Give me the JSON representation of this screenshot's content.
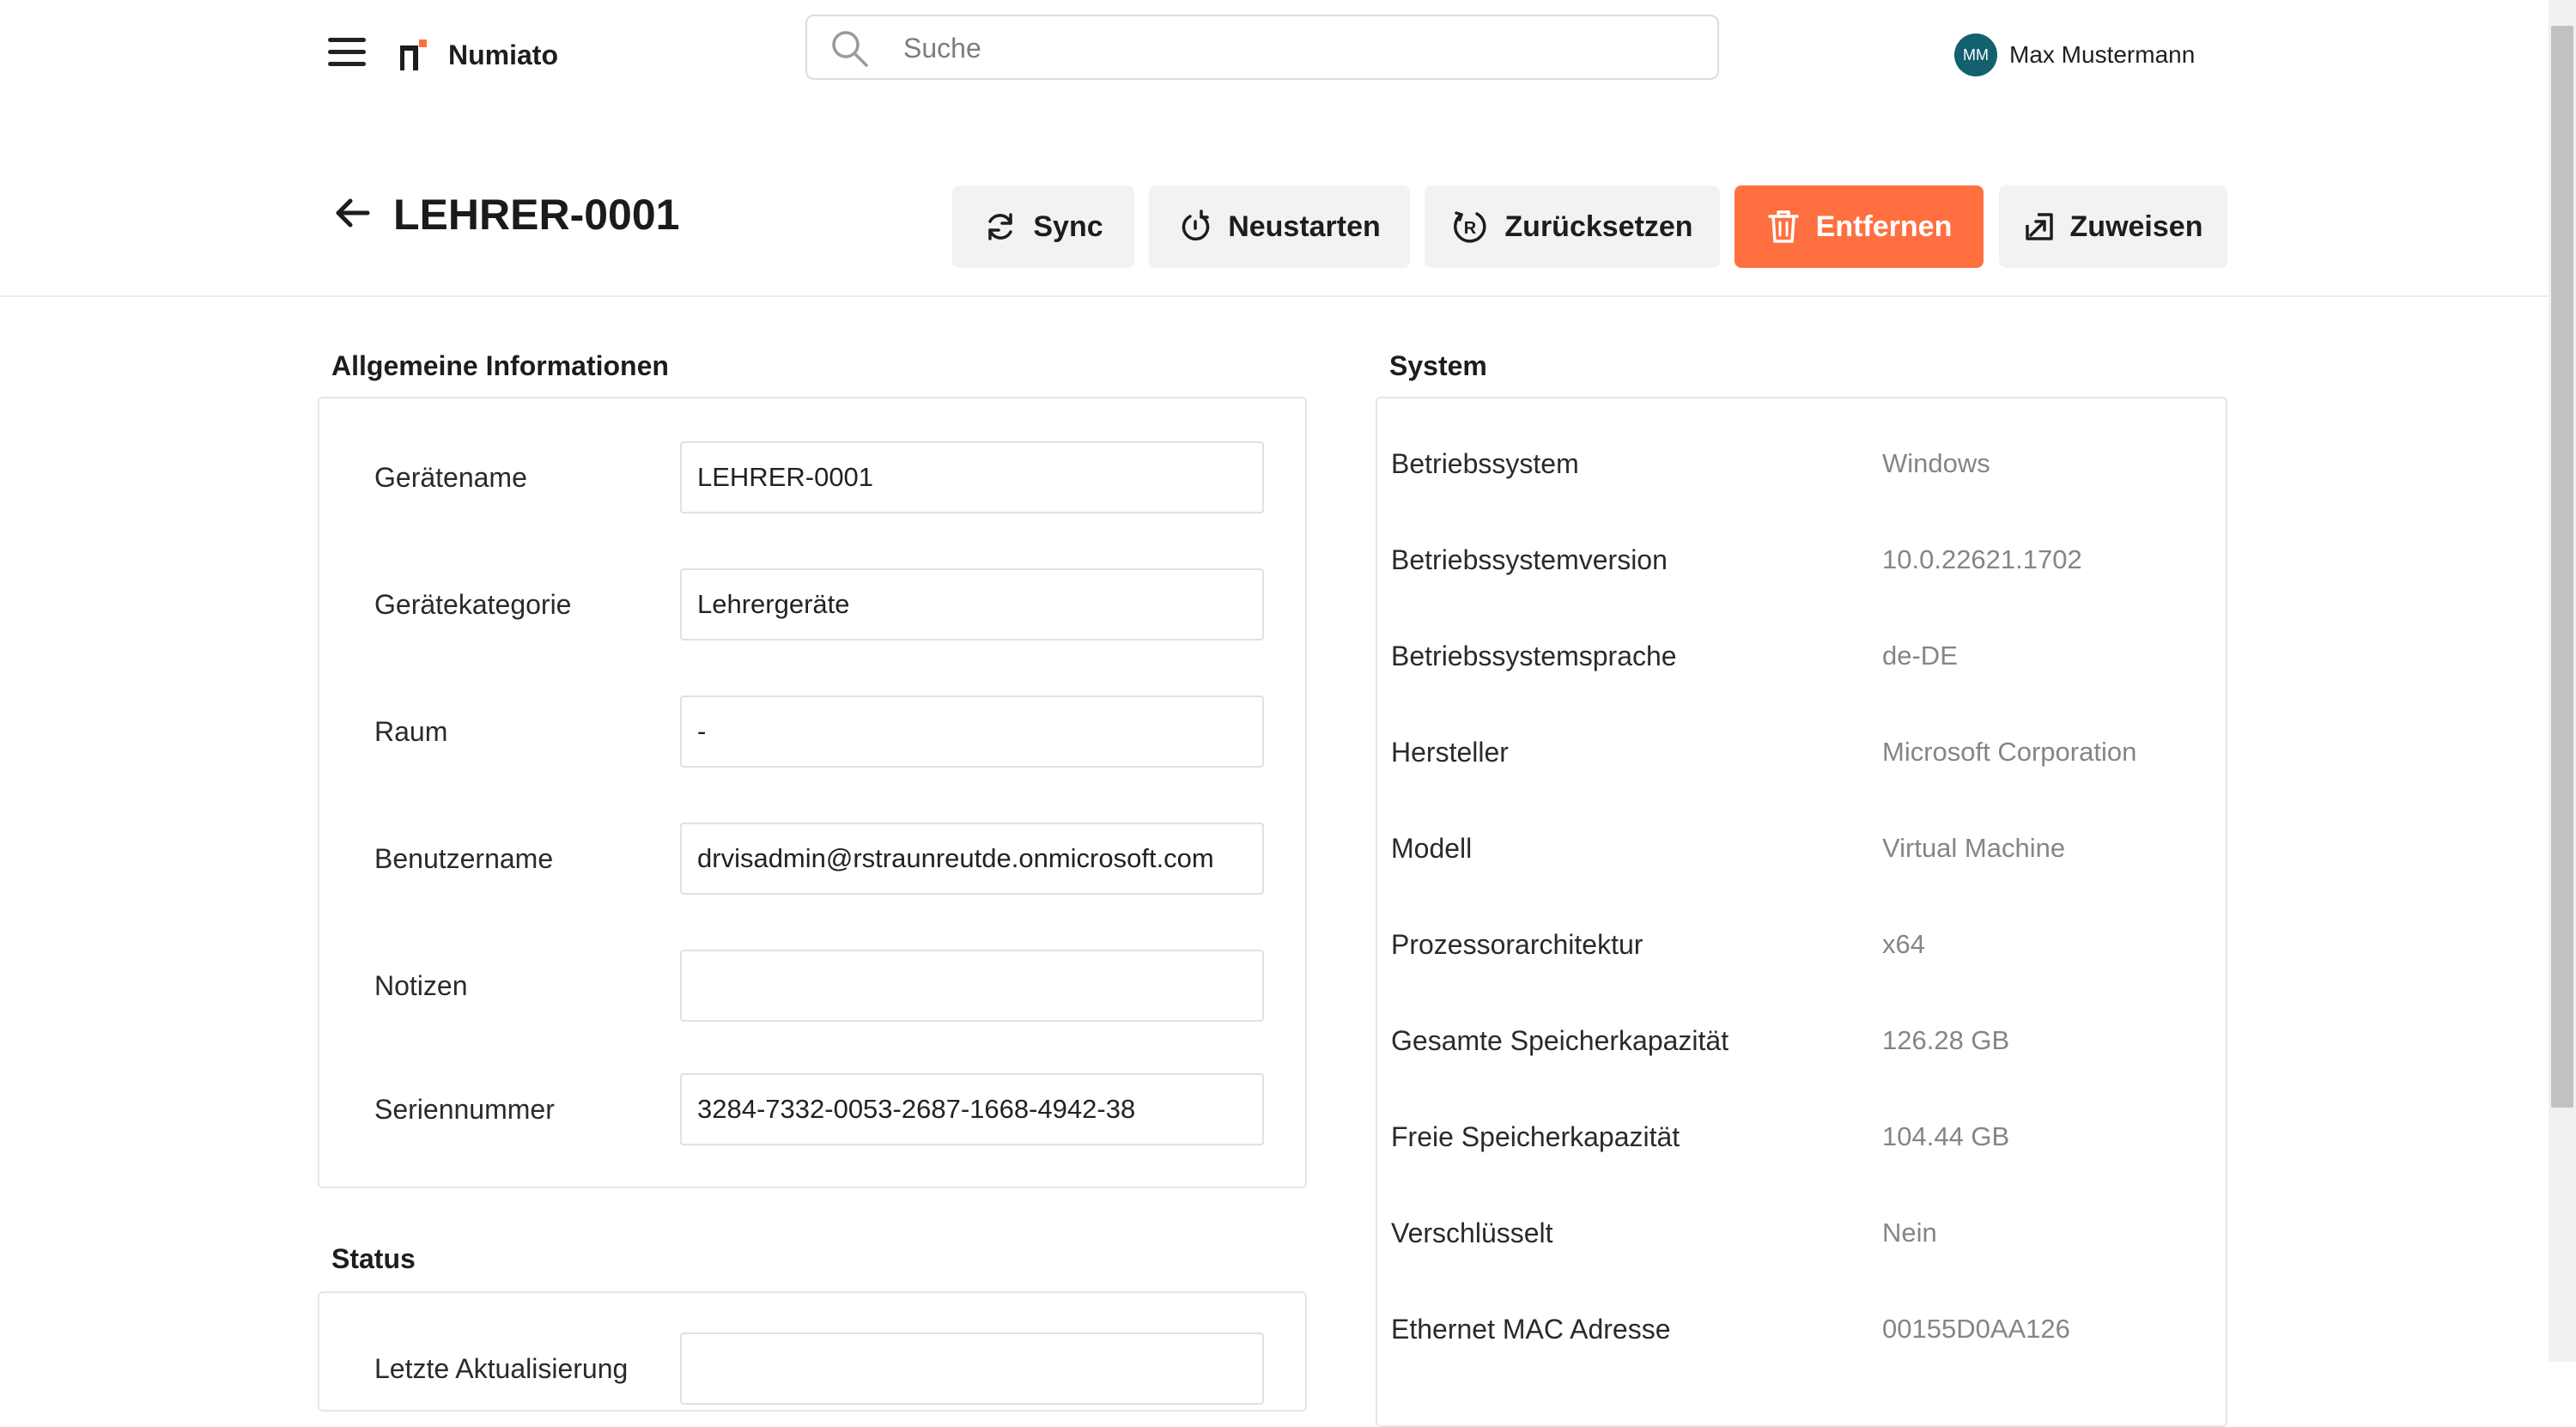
{
  "app": {
    "brand": "Numiato"
  },
  "search": {
    "placeholder": "Suche"
  },
  "user": {
    "initials": "MM",
    "name": "Max Mustermann"
  },
  "device": {
    "title": "LEHRER-0001"
  },
  "actions": {
    "sync": "Sync",
    "restart": "Neustarten",
    "reset": "Zurücksetzen",
    "remove": "Entfernen",
    "assign": "Zuweisen"
  },
  "colors": {
    "danger": "#ff6f40",
    "avatar": "#13606e",
    "secondary_button": "#f2f2f2"
  },
  "general": {
    "title": "Allgemeine Informationen",
    "fields": [
      {
        "label": "Gerätename",
        "value": "LEHRER-0001"
      },
      {
        "label": "Gerätekategorie",
        "value": "Lehrergeräte"
      },
      {
        "label": "Raum",
        "value": "-"
      },
      {
        "label": "Benutzername",
        "value": "drvisadmin@rstraunreutde.onmicrosoft.com"
      },
      {
        "label": "Notizen",
        "value": ""
      },
      {
        "label": "Seriennummer",
        "value": "3284-7332-0053-2687-1668-4942-38"
      }
    ]
  },
  "status": {
    "title": "Status",
    "first_label": "Letzte Aktualisierung"
  },
  "system": {
    "title": "System",
    "rows": [
      {
        "label": "Betriebssystem",
        "value": "Windows"
      },
      {
        "label": "Betriebssystemversion",
        "value": "10.0.22621.1702"
      },
      {
        "label": "Betriebssystemsprache",
        "value": "de-DE"
      },
      {
        "label": "Hersteller",
        "value": "Microsoft Corporation"
      },
      {
        "label": "Modell",
        "value": "Virtual Machine"
      },
      {
        "label": "Prozessorarchitektur",
        "value": "x64"
      },
      {
        "label": "Gesamte Speicherkapazität",
        "value": "126.28 GB"
      },
      {
        "label": "Freie Speicherkapazität",
        "value": "104.44 GB"
      },
      {
        "label": "Verschlüsselt",
        "value": "Nein"
      },
      {
        "label": "Ethernet MAC Adresse",
        "value": "00155D0AA126"
      }
    ]
  }
}
